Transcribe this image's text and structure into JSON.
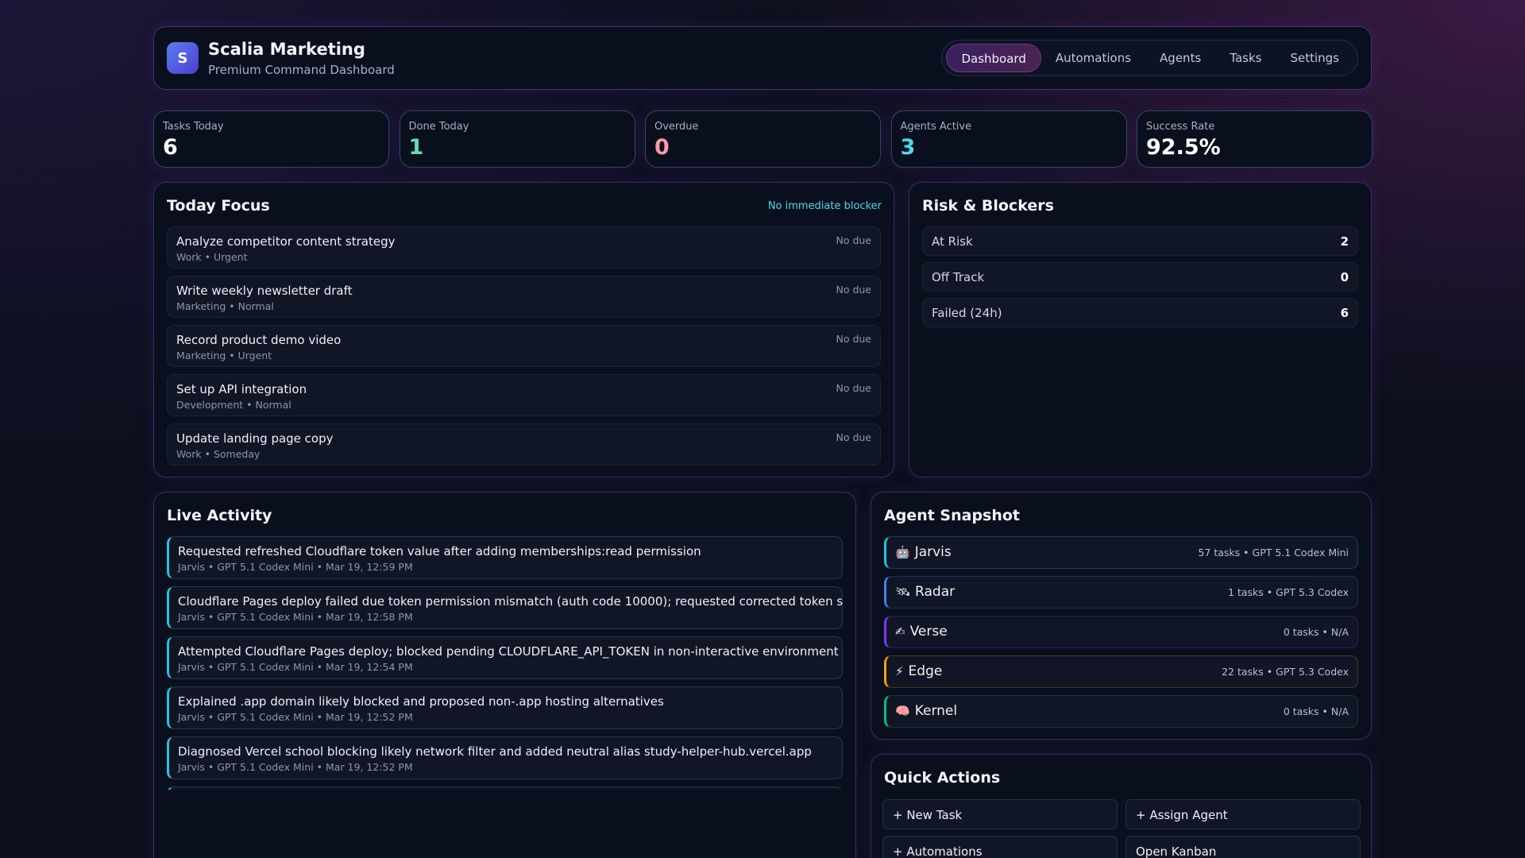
{
  "header": {
    "logo_letter": "S",
    "title": "Scalia Marketing",
    "subtitle": "Premium Command Dashboard",
    "nav": [
      {
        "label": "Dashboard",
        "active": true
      },
      {
        "label": "Automations"
      },
      {
        "label": "Agents"
      },
      {
        "label": "Tasks"
      },
      {
        "label": "Settings"
      }
    ]
  },
  "stats": [
    {
      "label": "Tasks Today",
      "value": "6",
      "color": "#ffffff"
    },
    {
      "label": "Done Today",
      "value": "1",
      "color": "#5fe0b0"
    },
    {
      "label": "Overdue",
      "value": "0",
      "color": "#f59aa5"
    },
    {
      "label": "Agents Active",
      "value": "3",
      "color": "#4fd8ee"
    },
    {
      "label": "Success Rate",
      "value": "92.5%",
      "color": "#ffffff"
    }
  ],
  "today_focus": {
    "title": "Today Focus",
    "status": "No immediate blocker",
    "items": [
      {
        "title": "Analyze competitor content strategy",
        "meta": "Work • Urgent",
        "due": "No due"
      },
      {
        "title": "Write weekly newsletter draft",
        "meta": "Marketing • Normal",
        "due": "No due"
      },
      {
        "title": "Record product demo video",
        "meta": "Marketing • Urgent",
        "due": "No due"
      },
      {
        "title": "Set up API integration",
        "meta": "Development • Normal",
        "due": "No due"
      },
      {
        "title": "Update landing page copy",
        "meta": "Work • Someday",
        "due": "No due"
      }
    ]
  },
  "risk": {
    "title": "Risk & Blockers",
    "items": [
      {
        "label": "At Risk",
        "value": "2"
      },
      {
        "label": "Off Track",
        "value": "0"
      },
      {
        "label": "Failed (24h)",
        "value": "6"
      }
    ]
  },
  "activity": {
    "title": "Live Activity",
    "items": [
      {
        "title": "Requested refreshed Cloudflare token value after adding memberships:read permission",
        "meta": "Jarvis • GPT 5.1 Codex Mini • Mar 19, 12:59 PM"
      },
      {
        "title": "Cloudflare Pages deploy failed due token permission mismatch (auth code 10000); requested corrected token scopes",
        "meta": "Jarvis • GPT 5.1 Codex Mini • Mar 19, 12:58 PM"
      },
      {
        "title": "Attempted Cloudflare Pages deploy; blocked pending CLOUDFLARE_API_TOKEN in non-interactive environment",
        "meta": "Jarvis • GPT 5.1 Codex Mini • Mar 19, 12:54 PM"
      },
      {
        "title": "Explained .app domain likely blocked and proposed non-.app hosting alternatives",
        "meta": "Jarvis • GPT 5.1 Codex Mini • Mar 19, 12:52 PM"
      },
      {
        "title": "Diagnosed Vercel school blocking likely network filter and added neutral alias study-helper-hub.vercel.app",
        "meta": "Jarvis • GPT 5.1 Codex Mini • Mar 19, 12:52 PM"
      }
    ]
  },
  "agents": {
    "title": "Agent Snapshot",
    "items": [
      {
        "icon": "🤖",
        "name": "Jarvis",
        "meta": "57 tasks • GPT 5.1 Codex Mini",
        "color": "#22c4e0"
      },
      {
        "icon": "🛰",
        "name": "Radar",
        "meta": "1 tasks • GPT 5.3 Codex",
        "color": "#3b82f6"
      },
      {
        "icon": "✍",
        "name": "Verse",
        "meta": "0 tasks • N/A",
        "color": "#7c3aed"
      },
      {
        "icon": "⚡",
        "name": "Edge",
        "meta": "22 tasks • GPT 5.3 Codex",
        "color": "#f59e0b"
      },
      {
        "icon": "🧠",
        "name": "Kernel",
        "meta": "0 tasks • N/A",
        "color": "#10b981"
      }
    ]
  },
  "quick_actions": {
    "title": "Quick Actions",
    "items": [
      "+ New Task",
      "+ Assign Agent",
      "+ Automations",
      "Open Kanban"
    ]
  }
}
